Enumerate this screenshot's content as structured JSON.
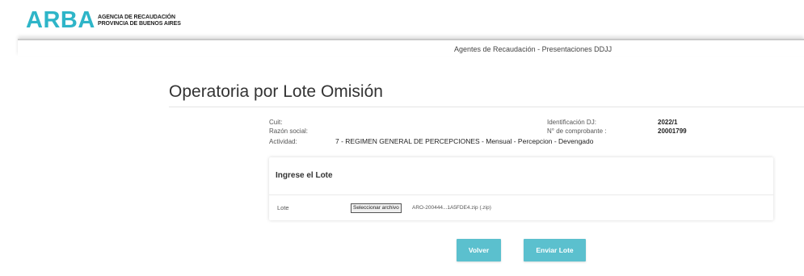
{
  "header": {
    "logo": "ARBA",
    "agency_line1": "AGENCIA DE RECAUDACIÓN",
    "agency_line2": "PROVINCIA DE BUENOS AIRES"
  },
  "subheader": {
    "title": "Agentes de Recaudación - Presentaciones DDJJ"
  },
  "page": {
    "title": "Operatoria por Lote Omisión"
  },
  "info": {
    "cuit_label": "Cuit:",
    "razon_label": "Razón social:",
    "actividad_label": "Actividad:",
    "actividad_value": "7 - REGIMEN GENERAL DE PERCEPCIONES - Mensual - Percepcion - Devengado",
    "identificacion_label": "Identificación DJ:",
    "identificacion_value": "2022/1",
    "comprobante_label": "N° de comprobante :",
    "comprobante_value": "20001799"
  },
  "card": {
    "title": "Ingrese el Lote",
    "lote_label": "Lote",
    "file_button": "Seleccionar archivo",
    "file_name": "ARO-200444...1A5FDE4.zip  (.zip)"
  },
  "buttons": {
    "volver": "Volver",
    "enviar": "Enviar Lote"
  },
  "colors": {
    "brand": "#2eb5c8",
    "button": "#5bc0ce"
  }
}
